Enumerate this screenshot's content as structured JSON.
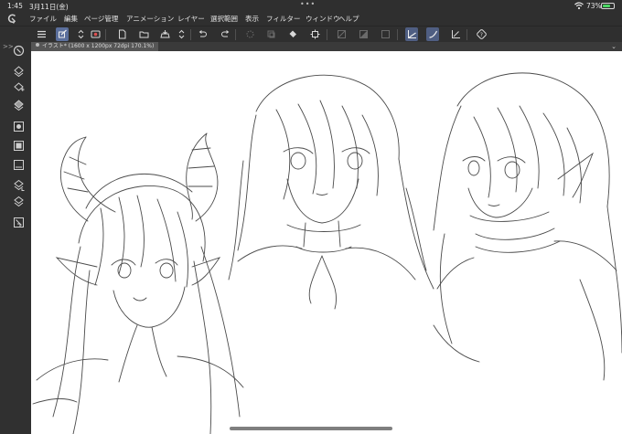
{
  "status_bar": {
    "time": "1:45",
    "date": "3月11日(金)",
    "multitask_dots": "•••",
    "battery_percent": "73%",
    "battery_level": 0.73,
    "wifi_icon": "wifi-icon"
  },
  "menu": {
    "items": [
      "ファイル",
      "編集",
      "ページ管理",
      "アニメーション",
      "レイヤー",
      "選択範囲",
      "表示",
      "フィルター",
      "ウィンドウ",
      "ヘルプ"
    ]
  },
  "command_bar": {
    "buttons": [
      "menu-icon",
      "layer-property-icon",
      "stepper-icon",
      "companion-mode-icon",
      "new-file-icon",
      "open-file-icon",
      "save-icon",
      "stepper-icon",
      "undo-icon",
      "redo-icon",
      "loading-icon",
      "clear-icon",
      "fill-icon",
      "transform-icon",
      "deselect-icon",
      "invert-selection-icon",
      "show-selection-icon",
      "snap-ruler-icon",
      "snap-special-ruler-icon",
      "snap-grid-icon",
      "quick-access-icon"
    ]
  },
  "tools": {
    "icons": [
      "reset-view-icon",
      "fill-layer-icon",
      "new-raster-layer-icon",
      "new-vector-layer-icon",
      "hide-layer-icon",
      "layer-color-icon",
      "layer-mask-icon",
      "merge-layer-icon",
      "delete-layer-icon"
    ]
  },
  "canvas": {
    "tab_title": "イラスト* (1600 x 1200px 72dpi 170.1%)",
    "collapse_label": ">>",
    "expand_label": "⌄",
    "background": "#ffffff",
    "sketch_color": "#2b2b2b"
  },
  "colors": {
    "ui_dark": "#2f2f2f",
    "accent_active": "#5b6f9c",
    "battery_green": "#4cd964"
  }
}
